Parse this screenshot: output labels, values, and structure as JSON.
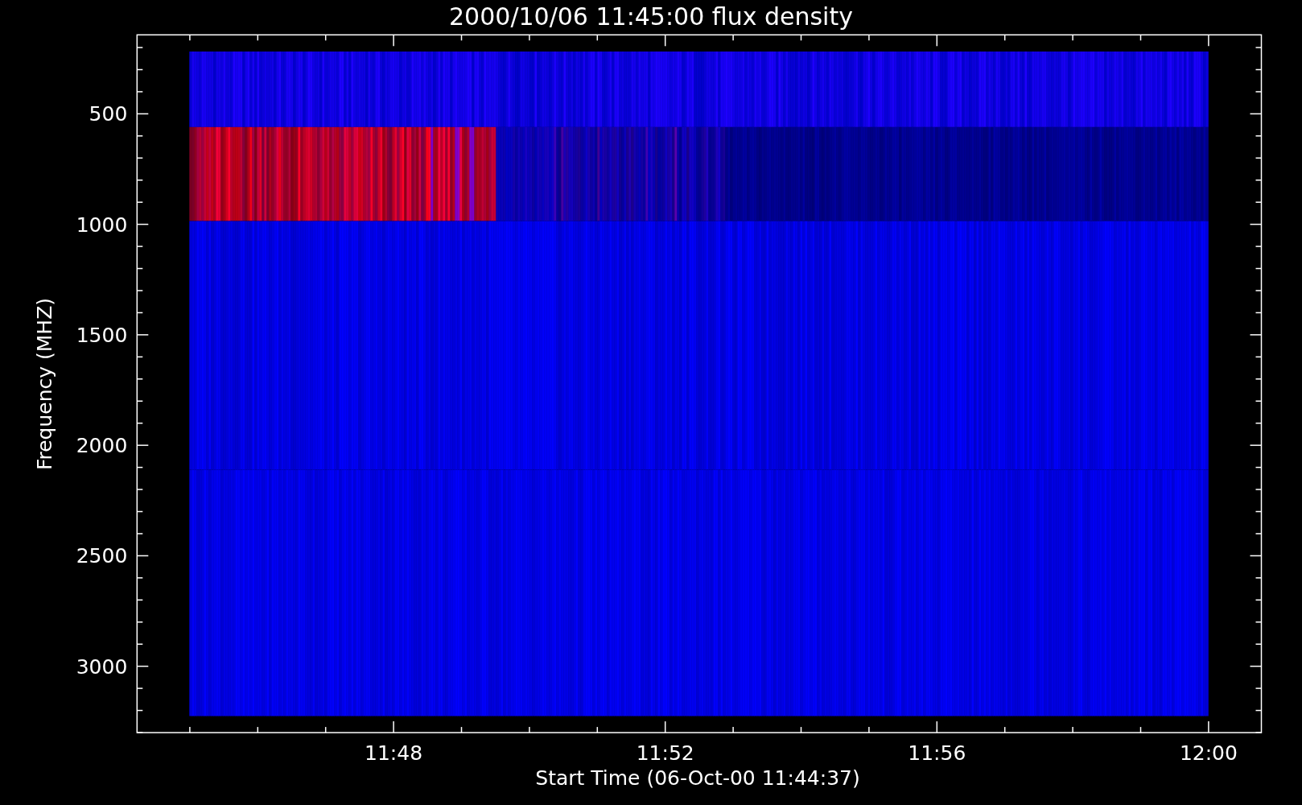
{
  "title": "2000/10/06 11:45:00 flux density",
  "y_axis": {
    "label": "Frequency (MHZ)",
    "ticks": [
      "500",
      "1000",
      "1500",
      "2000",
      "2500",
      "3000"
    ]
  },
  "x_axis": {
    "label": "Start Time (06-Oct-00 11:44:37)",
    "ticks": [
      "11:48",
      "11:52",
      "11:56",
      "12:00"
    ]
  }
}
